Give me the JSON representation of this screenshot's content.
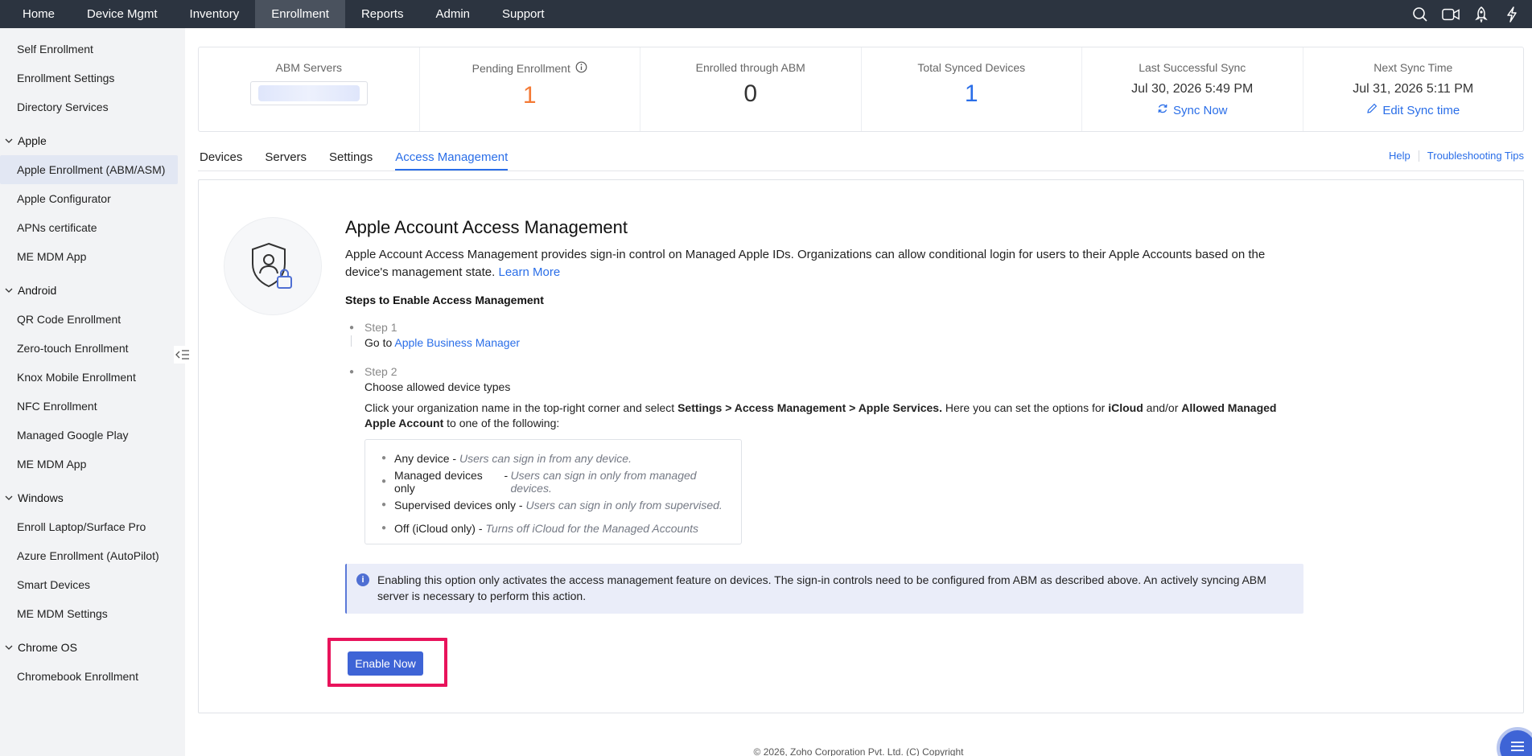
{
  "topnav": {
    "items": [
      "Home",
      "Device Mgmt",
      "Inventory",
      "Enrollment",
      "Reports",
      "Admin",
      "Support"
    ],
    "active": "Enrollment",
    "icons": [
      "search-icon",
      "video-icon",
      "rocket-icon",
      "bolt-icon"
    ]
  },
  "sidebar": {
    "top_items": [
      "Self Enrollment",
      "Enrollment Settings",
      "Directory Services"
    ],
    "groups": [
      {
        "label": "Apple",
        "items": [
          "Apple Enrollment (ABM/ASM)",
          "Apple Configurator",
          "APNs certificate",
          "ME MDM App"
        ]
      },
      {
        "label": "Android",
        "items": [
          "QR Code Enrollment",
          "Zero-touch Enrollment",
          "Knox Mobile Enrollment",
          "NFC Enrollment",
          "Managed Google Play",
          "ME MDM App"
        ]
      },
      {
        "label": "Windows",
        "items": [
          "Enroll Laptop/Surface Pro",
          "Azure Enrollment (AutoPilot)",
          "Smart Devices",
          "ME MDM Settings"
        ]
      },
      {
        "label": "Chrome OS",
        "items": [
          "Chromebook Enrollment"
        ]
      }
    ]
  },
  "stats": {
    "abm_servers": "ABM Servers",
    "pending": {
      "label": "Pending Enrollment",
      "value": "1"
    },
    "enrolled": {
      "label": "Enrolled through ABM",
      "value": "0"
    },
    "total": {
      "label": "Total Synced Devices",
      "value": "1"
    },
    "last_sync": {
      "label": "Last Successful Sync",
      "time": "Jul 30, 2026 5:49 PM",
      "action": "Sync Now"
    },
    "next_sync": {
      "label": "Next Sync Time",
      "time": "Jul 31, 2026 5:11 PM",
      "action": "Edit Sync time"
    }
  },
  "tabs": {
    "items": [
      "Devices",
      "Servers",
      "Settings",
      "Access Management"
    ],
    "active": "Access Management",
    "help": "Help",
    "troubleshooting": "Troubleshooting Tips"
  },
  "content": {
    "title": "Apple Account Access Management",
    "desc": "Apple Account Access Management provides sign-in control on Managed Apple IDs. Organizations can allow conditional login for users to their Apple Accounts based on the device's management state.",
    "learn_more": "Learn More",
    "steps_title": "Steps to Enable Access Management",
    "step1": {
      "label": "Step 1",
      "prefix": "Go to",
      "link": "Apple Business Manager"
    },
    "step2": {
      "label": "Step 2",
      "text": "Choose allowed device types",
      "detail_1": "Click your organization name in the top-right corner and select",
      "detail_path": "Settings > Access Management > Apple Services.",
      "detail_2": "Here you can set the options for",
      "detail_icloud": "iCloud",
      "detail_3": "and/or",
      "detail_allowed": "Allowed Managed Apple Account",
      "detail_4": "to one of the following:"
    },
    "options": [
      {
        "name": "Any device",
        "desc": "Users can sign in from any device."
      },
      {
        "name": "Managed devices only",
        "desc": "Users can sign in only from managed devices."
      },
      {
        "name": "Supervised devices only",
        "desc": "Users can sign in only from supervised."
      },
      {
        "name": "Off (iCloud only)",
        "desc": "Turns off iCloud for the Managed Accounts"
      }
    ],
    "info": "Enabling this option only activates the access management feature on devices. The sign-in controls need to be configured from ABM as described above. An actively syncing ABM server is necessary to perform this action.",
    "enable_button": "Enable Now"
  },
  "footer": "© 2026, Zoho Corporation Pvt. Ltd. (C) Copyright",
  "colors": {
    "accent": "#2a6ee8",
    "nav_bg": "#2c3440",
    "pending": "#f47a35",
    "highlight": "#e8135b",
    "button": "#3e64d6"
  }
}
